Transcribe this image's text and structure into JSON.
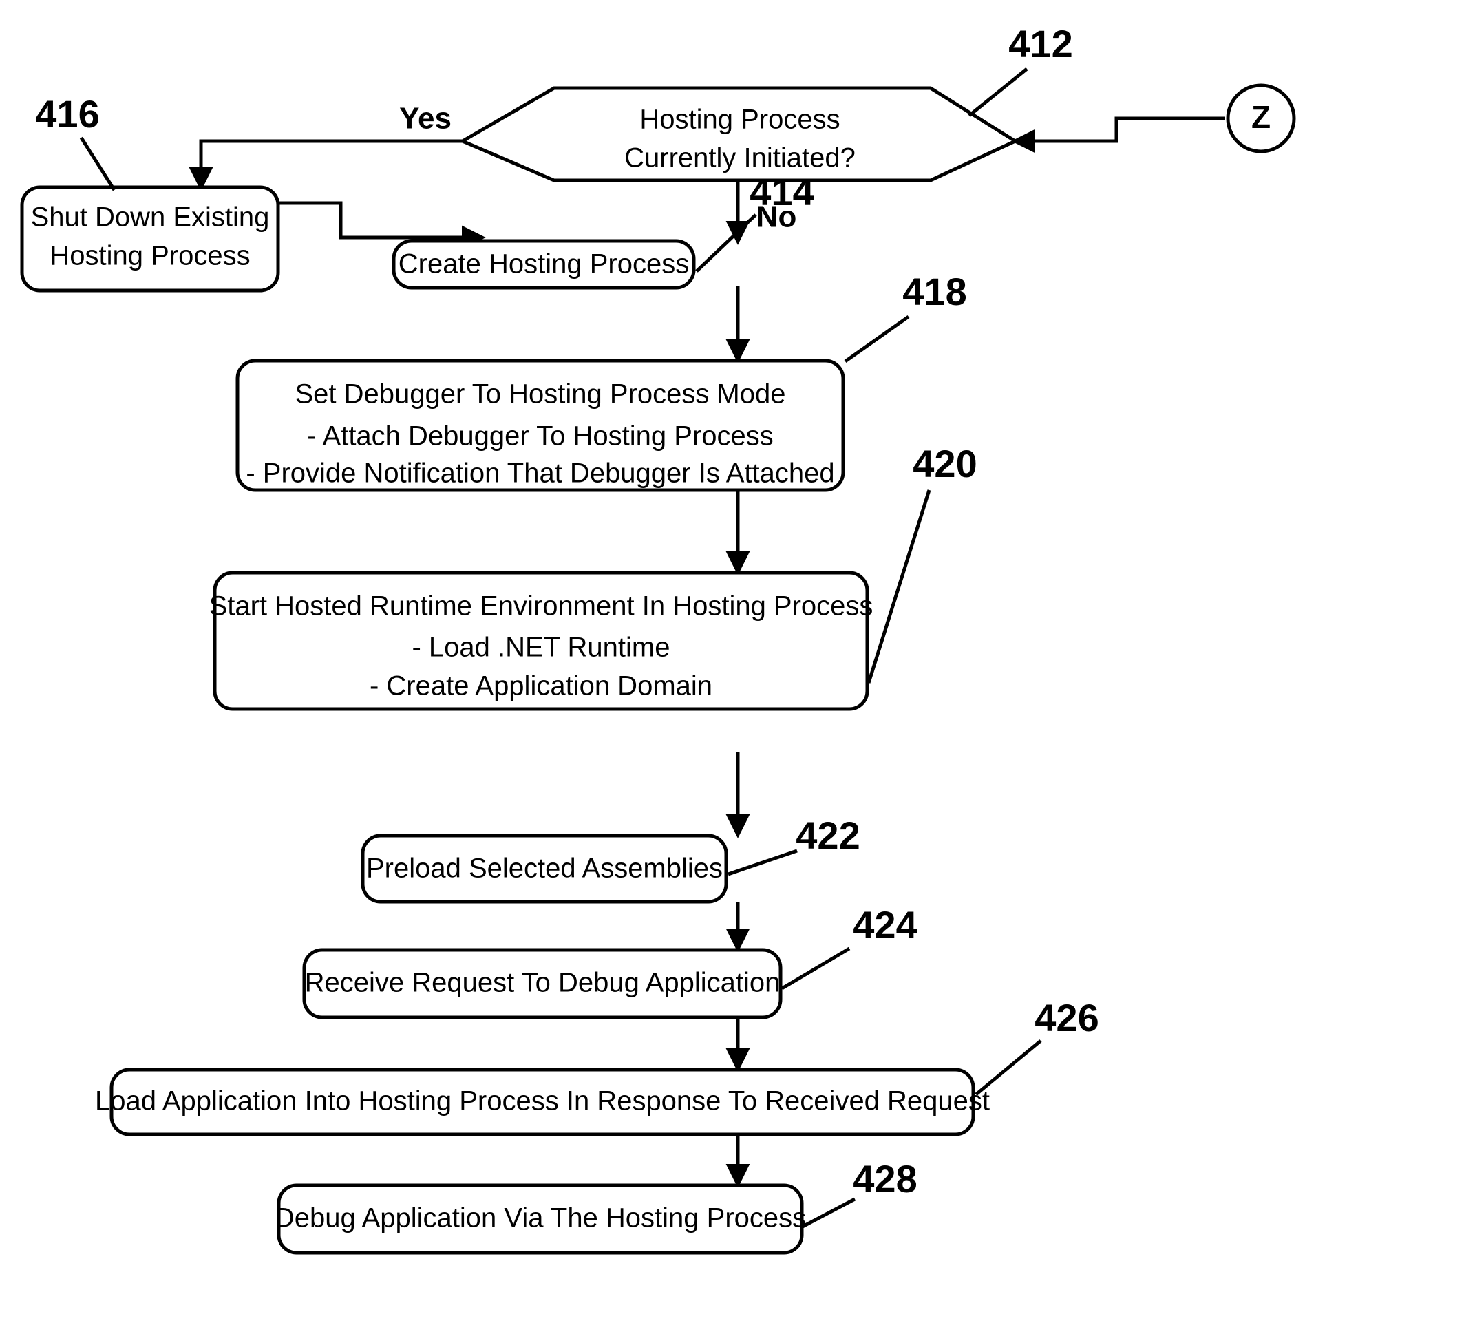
{
  "figure": {
    "type": "flowchart",
    "background": "#ffffff",
    "ink": "#000000"
  },
  "nodes": {
    "decision_412": {
      "ref": "412",
      "shape": "hexagon",
      "line1": "Hosting Process",
      "line2": "Currently Initiated?"
    },
    "box_416": {
      "ref": "416",
      "shape": "rounded-rect",
      "line1": "Shut Down Existing",
      "line2": "Hosting Process"
    },
    "box_414": {
      "ref": "414",
      "shape": "rounded-rect",
      "line1": "Create Hosting Process"
    },
    "box_418": {
      "ref": "418",
      "shape": "rounded-rect",
      "line1": "Set Debugger To Hosting Process Mode",
      "line2": "- Attach Debugger To Hosting Process",
      "line3": "- Provide Notification That Debugger Is Attached"
    },
    "box_420": {
      "ref": "420",
      "shape": "rounded-rect",
      "line1": "Start Hosted Runtime Environment In Hosting Process",
      "line2": "- Load .NET Runtime",
      "line3": "- Create Application Domain"
    },
    "box_422": {
      "ref": "422",
      "shape": "rounded-rect",
      "line1": "Preload Selected Assemblies"
    },
    "box_424": {
      "ref": "424",
      "shape": "rounded-rect",
      "line1": "Receive Request To Debug Application"
    },
    "box_426": {
      "ref": "426",
      "shape": "rounded-rect",
      "line1": "Load Application Into Hosting Process In Response To Received Request"
    },
    "box_428": {
      "ref": "428",
      "shape": "rounded-rect",
      "line1": "Debug Application Via The Hosting Process"
    },
    "connector_z": {
      "shape": "circle",
      "label": "Z"
    }
  },
  "branches": {
    "yes_label": "Yes",
    "no_label": "No"
  }
}
